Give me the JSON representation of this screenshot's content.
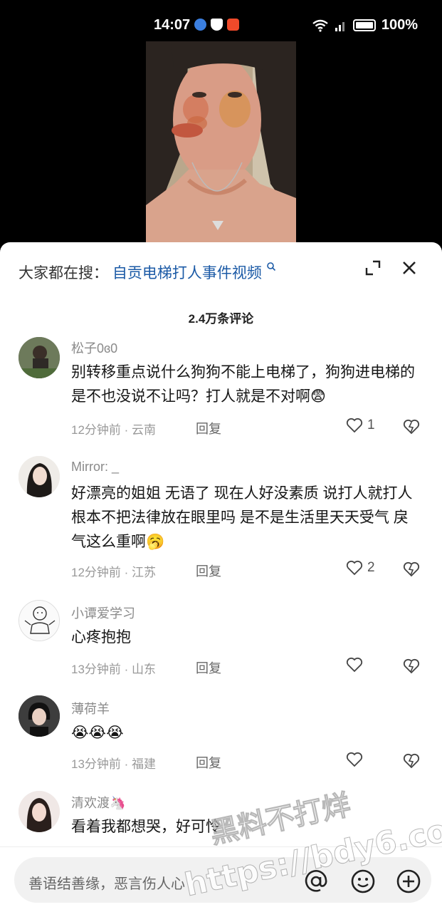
{
  "status": {
    "time": "14:07",
    "battery": "100%"
  },
  "search": {
    "prefix": "大家都在搜：",
    "query": "自贡电梯打人事件视频"
  },
  "comments_count": "2.4万条评论",
  "comments": [
    {
      "name": "松子0ɞ0",
      "text": "别转移重点说什么狗狗不能上电梯了，狗狗进电梯的是不也没说不让吗？打人就是不对啊😨",
      "meta": "12分钟前 · 云南",
      "reply": "回复",
      "likes": "1"
    },
    {
      "name": "Mirror: _",
      "text": "好漂亮的姐姐 无语了 现在人好没素质 说打人就打人 根本不把法律放在眼里吗 是不是生活里天天受气 戾气这么重啊🥱",
      "meta": "12分钟前 · 江苏",
      "reply": "回复",
      "likes": "2"
    },
    {
      "name": "小谭爱学习",
      "text": "心疼抱抱",
      "meta": "13分钟前 · 山东",
      "reply": "回复",
      "likes": ""
    },
    {
      "name": "薄荷羊",
      "text": "😭😭😭",
      "meta": "13分钟前 · 福建",
      "reply": "回复",
      "likes": ""
    },
    {
      "name": "清欢渡🦄",
      "text": "看着我都想哭，好可怜",
      "meta": "",
      "reply": "",
      "likes": ""
    }
  ],
  "input": {
    "placeholder": "善语结善缘，恶言伤人心"
  },
  "watermark": {
    "line1": "黑料不打烊",
    "line2": "https://bdy6.co"
  },
  "colors": {
    "link": "#1b5aa6",
    "sheet_bg": "#ffffff",
    "status_bg": "#000000"
  },
  "icons": [
    "search-icon",
    "expand-icon",
    "close-icon",
    "heart-icon",
    "dislike-heart-icon",
    "at-icon",
    "emoji-icon",
    "add-icon"
  ]
}
